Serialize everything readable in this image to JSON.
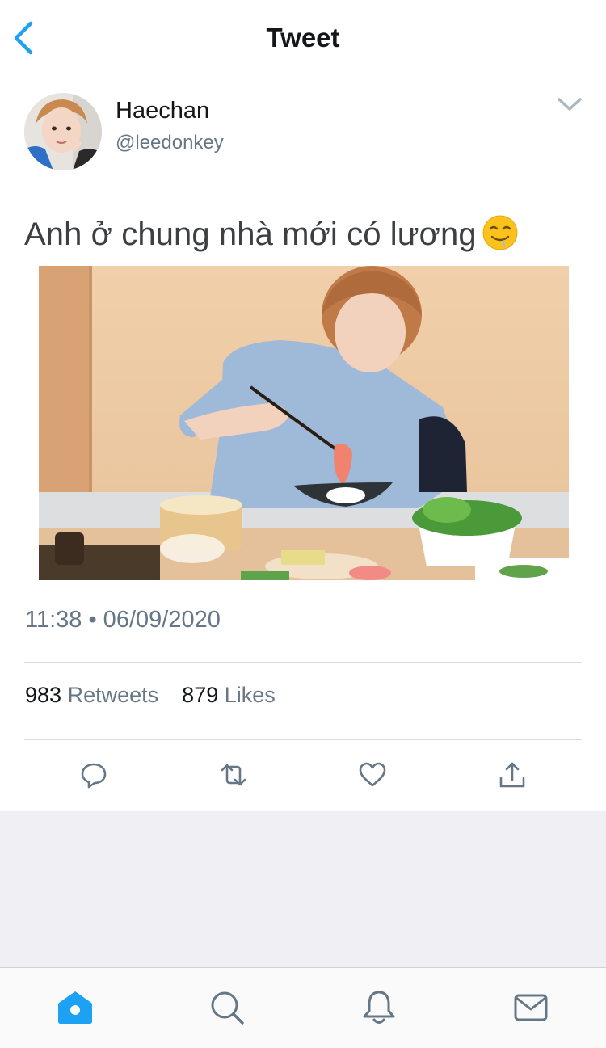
{
  "header": {
    "title": "Tweet",
    "back_icon": "chevron-left-icon"
  },
  "tweet": {
    "author_name": "Haechan",
    "author_handle": "@leedonkey",
    "text": "Anh ở chung nhà mới có lương",
    "emoji": "drooling-face",
    "timestamp": "11:38 • 06/09/2020",
    "retweets_count": "983",
    "retweets_label": "Retweets",
    "likes_count": "879",
    "likes_label": "Likes"
  },
  "actions": [
    "reply-icon",
    "retweet-icon",
    "like-icon",
    "share-icon"
  ],
  "tabbar": {
    "items": [
      "home-icon",
      "search-icon",
      "notifications-icon",
      "messages-icon"
    ],
    "active": "home-icon"
  },
  "colors": {
    "accent": "#1da1f2",
    "text": "#14171a",
    "secondary": "#657786",
    "background_gray": "#efeff4"
  }
}
